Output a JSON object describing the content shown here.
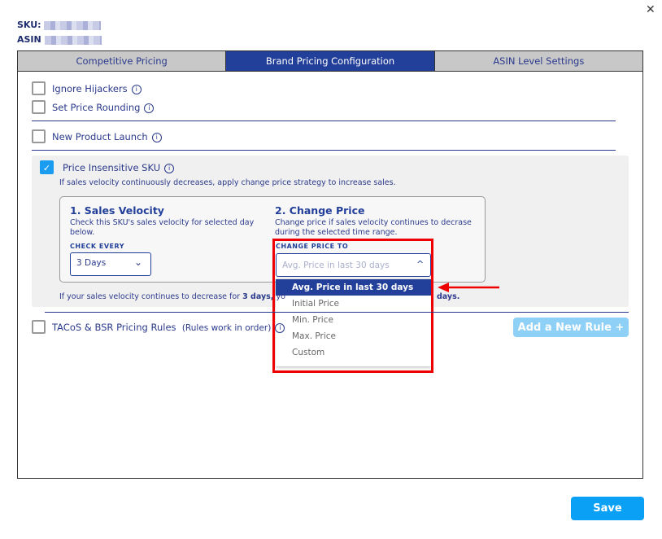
{
  "header": {
    "sku_label": "SKU:",
    "asin_label": "ASIN",
    "close_icon": "close-icon"
  },
  "tabs": [
    {
      "label": "Competitive Pricing"
    },
    {
      "label": "Brand Pricing Configuration",
      "active": true
    },
    {
      "label": "ASIN Level Settings"
    }
  ],
  "options": {
    "ignore_hijackers": "Ignore Hijackers",
    "set_price_rounding": "Set Price Rounding",
    "new_product_launch": "New Product Launch",
    "price_insensitive": "Price Insensitive SKU",
    "tacos": "TACoS & BSR Pricing Rules",
    "tacos_note": "(Rules work in order)"
  },
  "price_insensitive": {
    "checked": true,
    "description": "If sales velocity continuously decreases, apply change price strategy to increase sales.",
    "sales_velocity": {
      "title": "1. Sales Velocity",
      "desc": "Check this SKU's sales velocity for selected day below.",
      "field_label": "CHECK EVERY",
      "value": "3 Days"
    },
    "change_price": {
      "title": "2. Change Price",
      "desc": "Change price if sales velocity continues to decrase during the selected time range.",
      "field_label": "CHANGE PRICE TO",
      "placeholder": "Avg. Price in last 30 days",
      "options": [
        "Avg. Price in last 30 days",
        "Initial Price",
        "Min. Price",
        "Max. Price",
        "Custom"
      ],
      "selected": "Avg. Price in last 30 days"
    },
    "footer_pre": "If your sales velocity continues to decrease for ",
    "footer_days": "3 days,",
    "footer_post": " yo",
    "footer_end": "days."
  },
  "buttons": {
    "add_rule": "Add a New Rule +",
    "save": "Save"
  },
  "colors": {
    "accent": "#223f99",
    "save": "#0aa0f5",
    "add_rule": "#8fd0f7",
    "highlight": "#e00000"
  }
}
